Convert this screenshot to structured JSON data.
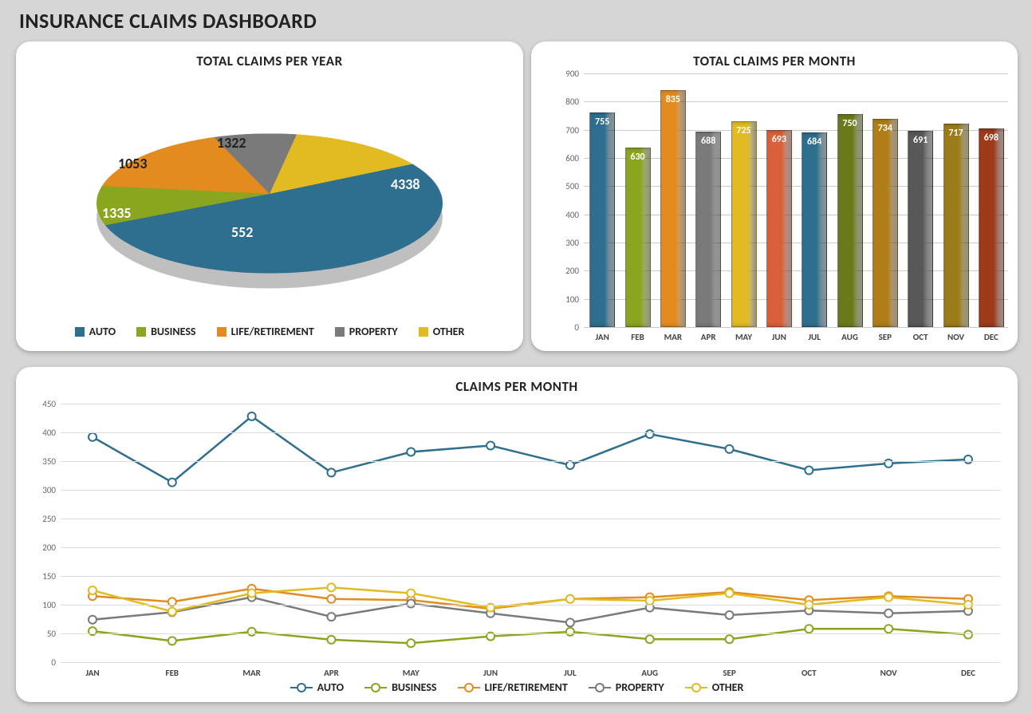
{
  "title": "INSURANCE CLAIMS DASHBOARD",
  "categories": {
    "auto": {
      "label": "AUTO",
      "color": "#2e6e8e"
    },
    "business": {
      "label": "BUSINESS",
      "color": "#8aa51e"
    },
    "life": {
      "label": "LIFE/RETIREMENT",
      "color": "#e38b1e"
    },
    "property": {
      "label": "PROPERTY",
      "color": "#7a7a7a"
    },
    "other": {
      "label": "OTHER",
      "color": "#e2bb22"
    }
  },
  "months": [
    "JAN",
    "FEB",
    "MAR",
    "APR",
    "MAY",
    "JUN",
    "JUL",
    "AUG",
    "SEP",
    "OCT",
    "NOV",
    "DEC"
  ],
  "pie": {
    "title": "TOTAL CLAIMS PER YEAR",
    "slices": [
      {
        "key": "auto",
        "value": 4338
      },
      {
        "key": "business",
        "value": 552
      },
      {
        "key": "life",
        "value": 1335
      },
      {
        "key": "property",
        "value": 1053
      },
      {
        "key": "other",
        "value": 1322
      }
    ]
  },
  "bar": {
    "title": "TOTAL CLAIMS PER MONTH",
    "ylim": [
      0,
      900
    ],
    "ystep": 100,
    "values": [
      755,
      630,
      835,
      688,
      725,
      693,
      684,
      750,
      734,
      691,
      717,
      698
    ],
    "colors": [
      "#2e6e8e",
      "#8aa51e",
      "#e38b1e",
      "#7a7a7a",
      "#e2bb22",
      "#d9603a",
      "#2e6e8e",
      "#6a7a1a",
      "#b07e18",
      "#585858",
      "#9c7c18",
      "#9c3a1a"
    ]
  },
  "line": {
    "title": "CLAIMS PER MONTH",
    "ylim": [
      0,
      450
    ],
    "ystep": 50,
    "series": [
      {
        "key": "auto",
        "values": [
          392,
          313,
          428,
          330,
          366,
          377,
          343,
          397,
          371,
          334,
          346,
          353
        ]
      },
      {
        "key": "business",
        "values": [
          54,
          37,
          53,
          39,
          33,
          45,
          53,
          40,
          40,
          58,
          58,
          48
        ]
      },
      {
        "key": "life",
        "values": [
          115,
          105,
          128,
          110,
          108,
          93,
          110,
          113,
          122,
          108,
          115,
          110
        ]
      },
      {
        "key": "property",
        "values": [
          74,
          87,
          113,
          79,
          102,
          85,
          69,
          95,
          82,
          90,
          85,
          89
        ]
      },
      {
        "key": "other",
        "values": [
          125,
          88,
          120,
          130,
          120,
          95,
          110,
          107,
          120,
          100,
          113,
          100
        ]
      }
    ]
  },
  "chart_data": [
    {
      "type": "pie",
      "title": "TOTAL CLAIMS PER YEAR",
      "categories": [
        "AUTO",
        "BUSINESS",
        "LIFE/RETIREMENT",
        "PROPERTY",
        "OTHER"
      ],
      "values": [
        4338,
        552,
        1335,
        1053,
        1322
      ]
    },
    {
      "type": "bar",
      "title": "TOTAL CLAIMS PER MONTH",
      "categories": [
        "JAN",
        "FEB",
        "MAR",
        "APR",
        "MAY",
        "JUN",
        "JUL",
        "AUG",
        "SEP",
        "OCT",
        "NOV",
        "DEC"
      ],
      "values": [
        755,
        630,
        835,
        688,
        725,
        693,
        684,
        750,
        734,
        691,
        717,
        698
      ],
      "ylim": [
        0,
        900
      ]
    },
    {
      "type": "line",
      "title": "CLAIMS PER MONTH",
      "x": [
        "JAN",
        "FEB",
        "MAR",
        "APR",
        "MAY",
        "JUN",
        "JUL",
        "AUG",
        "SEP",
        "OCT",
        "NOV",
        "DEC"
      ],
      "series": [
        {
          "name": "AUTO",
          "values": [
            392,
            313,
            428,
            330,
            366,
            377,
            343,
            397,
            371,
            334,
            346,
            353
          ]
        },
        {
          "name": "BUSINESS",
          "values": [
            54,
            37,
            53,
            39,
            33,
            45,
            53,
            40,
            40,
            58,
            58,
            48
          ]
        },
        {
          "name": "LIFE/RETIREMENT",
          "values": [
            115,
            105,
            128,
            110,
            108,
            93,
            110,
            113,
            122,
            108,
            115,
            110
          ]
        },
        {
          "name": "PROPERTY",
          "values": [
            74,
            87,
            113,
            79,
            102,
            85,
            69,
            95,
            82,
            90,
            85,
            89
          ]
        },
        {
          "name": "OTHER",
          "values": [
            125,
            88,
            120,
            130,
            120,
            95,
            110,
            107,
            120,
            100,
            113,
            100
          ]
        }
      ],
      "ylim": [
        0,
        450
      ]
    }
  ]
}
